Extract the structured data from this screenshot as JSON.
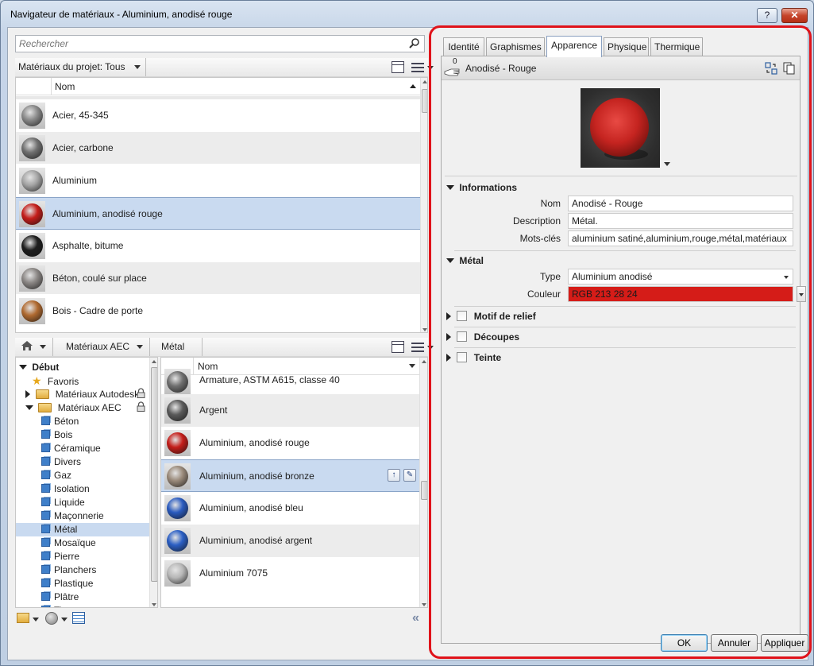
{
  "window": {
    "title": "Navigateur de matériaux - Aluminium, anodisé rouge",
    "help_label": "?",
    "close_label": "✕"
  },
  "search": {
    "placeholder": "Rechercher"
  },
  "project": {
    "filter_label": "Matériaux du projet: Tous",
    "column_name": "Nom",
    "materials": [
      {
        "name": "Acier, 45-345",
        "swatch": "#8a8a8a"
      },
      {
        "name": "Acier, carbone",
        "swatch": "#707070"
      },
      {
        "name": "Aluminium",
        "swatch": "#a6a6a6"
      },
      {
        "name": "Aluminium, anodisé rouge",
        "swatch": "#c41e1a"
      },
      {
        "name": "Asphalte, bitume",
        "swatch": "#1e1e1e"
      },
      {
        "name": "Béton, coulé sur place",
        "swatch": "#8b8785"
      },
      {
        "name": "Bois - Cadre de porte",
        "swatch": "#b06a30"
      }
    ]
  },
  "library": {
    "breadcrumb": [
      "Matériaux AEC",
      "Métal"
    ],
    "tree": {
      "root": "Début",
      "favorites": "Favoris",
      "libraries": [
        "Matériaux Autodesk",
        "Matériaux AEC"
      ],
      "categories": [
        "Béton",
        "Bois",
        "Céramique",
        "Divers",
        "Gaz",
        "Isolation",
        "Liquide",
        "Maçonnerie",
        "Métal",
        "Mosaïque",
        "Pierre",
        "Planchers",
        "Plastique",
        "Plâtre",
        "Tissu"
      ],
      "selected": "Métal"
    },
    "column_name": "Nom",
    "materials": [
      {
        "name": "Armature, ASTM A615, classe 40",
        "swatch": "#6f6f6f"
      },
      {
        "name": "Argent",
        "swatch": "#5a5a5a"
      },
      {
        "name": "Aluminium, anodisé rouge",
        "swatch": "#c41e1a"
      },
      {
        "name": "Aluminium, anodisé bronze",
        "swatch": "#9a8a7a"
      },
      {
        "name": "Aluminium, anodisé bleu",
        "swatch": "#2a5bbf"
      },
      {
        "name": "Aluminium, anodisé argent",
        "swatch": "#2b5fc4"
      },
      {
        "name": "Aluminium 7075",
        "swatch": "#b8b8b8"
      }
    ]
  },
  "tabs": [
    {
      "label": "Identité"
    },
    {
      "label": "Graphismes"
    },
    {
      "label": "Apparence",
      "active": true
    },
    {
      "label": "Physique"
    },
    {
      "label": "Thermique"
    }
  ],
  "asset": {
    "usage_count": "0",
    "name": "Anodisé - Rouge",
    "sections": {
      "info_title": "Informations",
      "metal_title": "Métal",
      "relief_title": "Motif de relief",
      "cutouts_title": "Découpes",
      "tint_title": "Teinte"
    },
    "info": {
      "name_label": "Nom",
      "name_value": "Anodisé - Rouge",
      "description_label": "Description",
      "description_value": "Métal.",
      "keywords_label": "Mots-clés",
      "keywords_value": "aluminium satiné,aluminium,rouge,métal,matériaux"
    },
    "metal": {
      "type_label": "Type",
      "type_value": "Aluminium anodisé",
      "color_label": "Couleur",
      "color_value": "RGB 213 28 24",
      "color_hex": "#d51c18"
    }
  },
  "buttons": {
    "ok": "OK",
    "cancel": "Annuler",
    "apply": "Appliquer"
  },
  "colors": {
    "selection": "#c9daf0",
    "highlight_outline": "#e0131a"
  }
}
